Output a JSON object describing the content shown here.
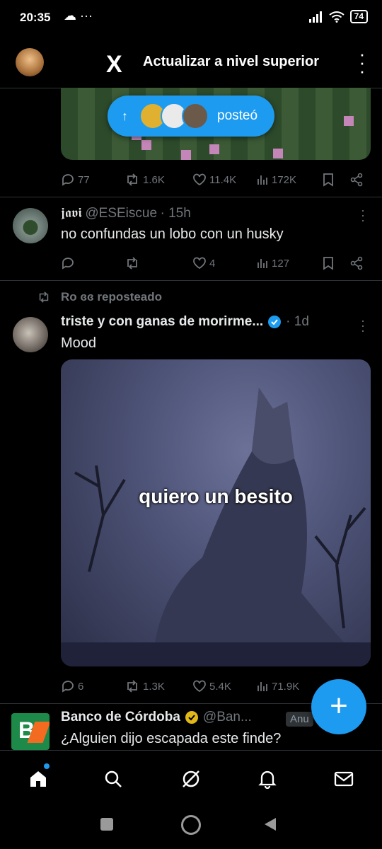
{
  "status_bar": {
    "time": "20:35",
    "extras": "☁ ···",
    "battery": "74"
  },
  "header": {
    "title": "Actualizar a nivel superior",
    "logo": "X"
  },
  "pill": {
    "label": "posteó"
  },
  "tweet1_actions": {
    "replies": "77",
    "reposts": "1.6K",
    "likes": "11.4K",
    "views": "172K"
  },
  "tweet2": {
    "name": "𝖏𝖆𝖛𝖎",
    "handle": "@ESEiscue",
    "time": "· 15h",
    "text": "no confundas un lobo con un husky",
    "actions": {
      "replies": "",
      "reposts": "",
      "likes": "4",
      "views": "127"
    }
  },
  "tweet3": {
    "repost_label": "Ro ɞɞ reposteado",
    "name": "triste y con ganas de morirme...",
    "time": "· 1d",
    "text": "Mood",
    "image_caption": "quiero un besito",
    "actions": {
      "replies": "6",
      "reposts": "1.3K",
      "likes": "5.4K",
      "views": "71.9K"
    }
  },
  "tweet4": {
    "name": "Banco de Córdoba",
    "handle": "@Ban...",
    "ad_label": "Anu",
    "text": "¿Alguien dijo escapada este finde?",
    "logo_text": "B"
  },
  "colors": {
    "accent": "#1d9bf0",
    "verified_blue": "#1d9bf0",
    "verified_gold": "#e2b719",
    "muted": "#71767b"
  },
  "icons": [
    "home-icon",
    "search-icon",
    "grok-icon",
    "bell-icon",
    "mail-icon"
  ]
}
